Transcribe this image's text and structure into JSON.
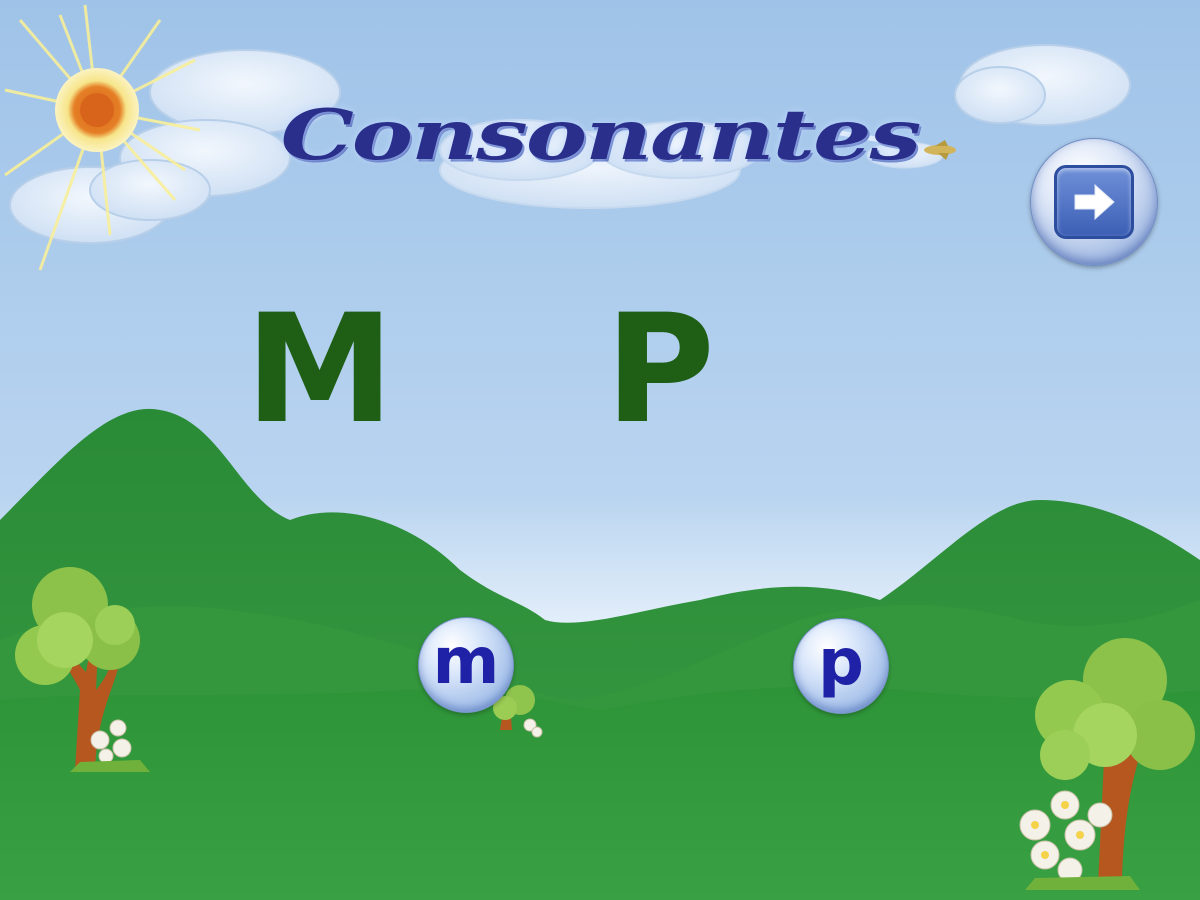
{
  "title": "Consonantes",
  "letters": {
    "uppercase": [
      "M",
      "P"
    ],
    "lowercase": [
      "m",
      "p"
    ]
  },
  "controls": {
    "next_icon": "arrow-right-icon"
  },
  "colors": {
    "sky_top": "#9fc3e8",
    "sky_bottom": "#e8f1fb",
    "hills": "#2f8f3a",
    "title": "#2b2f8c",
    "uppercase_letters": "#1e5e15",
    "lowercase_letters": "#1f22a6"
  }
}
